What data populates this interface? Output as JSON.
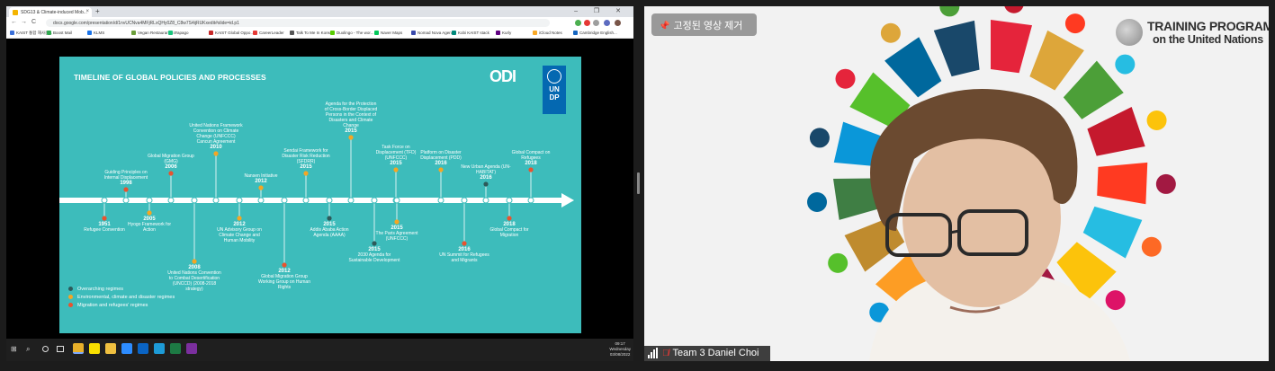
{
  "browser": {
    "tab_title": "SDG13 & Climate-induced Mob...",
    "tab_close": "×",
    "new_tab": "+",
    "window_controls": "–  ❐  ✕",
    "nav_back": "←",
    "nav_forward": "→",
    "nav_reload": "C",
    "url": "docs.google.com/presentation/d/1nvUCNva4MFjRLxQHy0Z8_C8w7S4ijRUKxedit#slide=id.p1",
    "bookmarks": [
      {
        "label": "KAIST 통합 재사용...",
        "color": "#3a6fd8"
      },
      {
        "label": "Boost Mail",
        "color": "#2fa84f"
      },
      {
        "label": "KLMS",
        "color": "#1a73e8"
      },
      {
        "label": "Vegan Restaurants i...",
        "color": "#6b9e3a"
      },
      {
        "label": "Papago",
        "color": "#19c37d"
      },
      {
        "label": "KAIST Global Oppo...",
        "color": "#c62828"
      },
      {
        "label": "CareerLeader",
        "color": "#e53935"
      },
      {
        "label": "Talk To Me In Korean",
        "color": "#555555"
      },
      {
        "label": "Duolingo - The wor...",
        "color": "#58cc02"
      },
      {
        "label": "Naver Maps",
        "color": "#03c75a"
      },
      {
        "label": "Nomad Nova Ageni...",
        "color": "#3949ab"
      },
      {
        "label": "Kobi KAIST stack",
        "color": "#00897b"
      },
      {
        "label": "Kurly",
        "color": "#5f0080"
      },
      {
        "label": "iCloud Notes",
        "color": "#f9a825"
      },
      {
        "label": "Cambridge English...",
        "color": "#1565c0"
      }
    ]
  },
  "slide": {
    "title": "TIMELINE OF GLOBAL POLICIES AND PROCESSES",
    "odi_logo": "ODI",
    "undp_logo": [
      "U",
      "N",
      "D",
      "P"
    ],
    "events_above": [
      {
        "year": "1998",
        "label": "Guiding Principles on Internal Displacement",
        "color": "#e8532f"
      },
      {
        "year": "2006",
        "label": "Global Migration Group (GMG)",
        "color": "#e8532f"
      },
      {
        "year": "2010",
        "label": "United Nations Framework Convention on Climate Change (UNFCCC) Cancun Agreement",
        "color": "#f5a623"
      },
      {
        "year": "2012",
        "label": "Nansen Initiative",
        "color": "#f5a623"
      },
      {
        "year": "2015",
        "label": "Sendai Framework for Disaster Risk Reduction (SFDRR)",
        "color": "#f5a623"
      },
      {
        "year": "2015",
        "label": "Agenda for the Protection of Cross-Border Displaced Persons in the Context of Disasters and Climate Change",
        "color": "#f5a623"
      },
      {
        "year": "2015",
        "label": "Task Force on Displacement (TFD) (UNFCCC)",
        "color": "#f5a623"
      },
      {
        "year": "2016",
        "label": "Platform on Disaster Displacement (PDD)",
        "color": "#f5a623"
      },
      {
        "year": "2016",
        "label": "New Urban Agenda (UN-HABITAT)",
        "color": "#2d5a5a"
      },
      {
        "year": "2018",
        "label": "Global Compact on Refugees",
        "color": "#e8532f"
      }
    ],
    "events_below": [
      {
        "year": "1951",
        "label": "Refugee Convention",
        "color": "#e8532f"
      },
      {
        "year": "2005",
        "label": "Hyogo Framework for Action",
        "color": "#f5a623"
      },
      {
        "year": "2008",
        "label": "United Nations Convention to Combat Desertification (UNCCD) (2008-2018 strategy)",
        "color": "#f5a623"
      },
      {
        "year": "2012",
        "label": "UN Advisory Group on Climate Change and Human Mobility",
        "color": "#f5a623"
      },
      {
        "year": "2012",
        "label": "Global Migration Group Working Group on Human Rights",
        "color": "#e8532f"
      },
      {
        "year": "2015",
        "label": "Addis Ababa Action Agenda (AAAA)",
        "color": "#2d5a5a"
      },
      {
        "year": "2015",
        "label": "2030 Agenda for Sustainable Development",
        "color": "#2d5a5a"
      },
      {
        "year": "2015",
        "label": "The Paris Agreement (UNFCCC)",
        "color": "#f5a623"
      },
      {
        "year": "2016",
        "label": "UN Summit for Refugees and Migrants",
        "color": "#e8532f"
      },
      {
        "year": "2018",
        "label": "Global Compact for Migration",
        "color": "#e8532f"
      }
    ],
    "legend": [
      {
        "label": "Overarching regimes",
        "color": "#2d5a5a"
      },
      {
        "label": "Environmental, climate and disaster regimes",
        "color": "#f5a623"
      },
      {
        "label": "Migration and refugees' regimes",
        "color": "#e8532f"
      }
    ]
  },
  "taskbar": {
    "start_icon": "⊞",
    "search_icon": "⌕",
    "clock_time": "09:17",
    "clock_day": "Wednesday",
    "clock_date": "03/08/2022",
    "apps": [
      {
        "name": "chrome",
        "color": "#e8b02a"
      },
      {
        "name": "kakaotalk",
        "color": "#f9e000"
      },
      {
        "name": "file-explorer",
        "color": "#f0c040"
      },
      {
        "name": "zoom",
        "color": "#2d8cff"
      },
      {
        "name": "outlook",
        "color": "#0a64c4"
      },
      {
        "name": "edge",
        "color": "#1d9bd7"
      },
      {
        "name": "excel",
        "color": "#1d7a44"
      },
      {
        "name": "onenote",
        "color": "#7b2f9e"
      }
    ]
  },
  "video": {
    "unpin_label": "고정된 영상 제거",
    "logo_line1": "TRAINING PROGRAM",
    "logo_line2": "on the United Nations",
    "participant_name": "Team 3 Daniel Choi",
    "sdg_colors": [
      "#e5243b",
      "#dda63a",
      "#4c9f38",
      "#c5192d",
      "#ff3a21",
      "#26bde2",
      "#fcc30b",
      "#a21942",
      "#fd6925",
      "#dd1367",
      "#fd9d24",
      "#bf8b2e",
      "#3f7e44",
      "#0a97d9",
      "#56c02b",
      "#00689d",
      "#19486a"
    ]
  }
}
